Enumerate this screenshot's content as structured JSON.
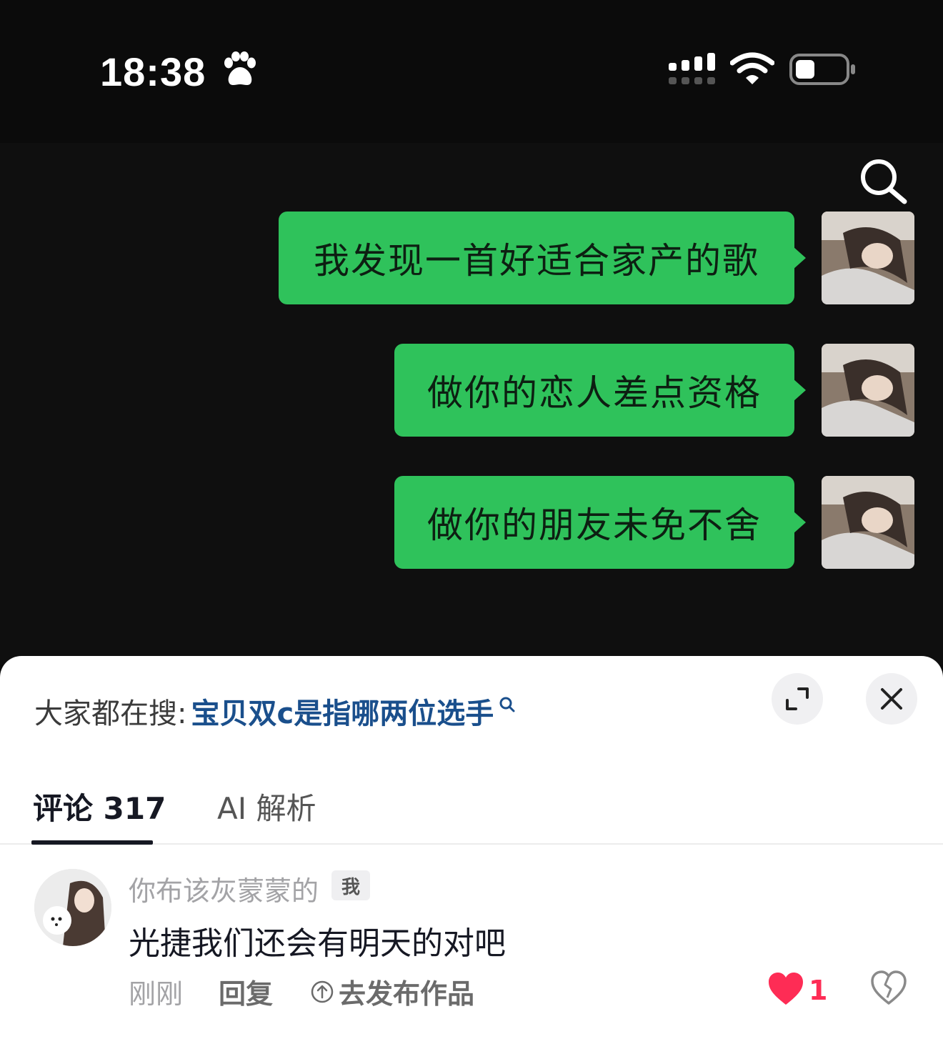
{
  "status_bar": {
    "time": "18:38",
    "icons": [
      "paw-icon",
      "cellular-signal-icon",
      "wifi-icon",
      "battery-icon"
    ]
  },
  "video": {
    "messages": [
      {
        "text": "我发现一首好适合家产的歌"
      },
      {
        "text": "做你的恋人差点资格"
      },
      {
        "text": "做你的朋友未免不舍"
      }
    ],
    "bubble_color": "#2fc25b"
  },
  "trending": {
    "label": "大家都在搜:",
    "query": "宝贝双c是指哪两位选手"
  },
  "tabs": [
    {
      "label": "评论 317",
      "active": true
    },
    {
      "label": "AI 解析",
      "active": false
    }
  ],
  "comment": {
    "username": "你布该灰蒙蒙的",
    "badge": "我",
    "text": "光捷我们还会有明天的对吧",
    "time": "刚刚",
    "reply_label": "回复",
    "publish_label": "去发布作品",
    "like_count": "1",
    "like_color": "#fe2c55"
  }
}
